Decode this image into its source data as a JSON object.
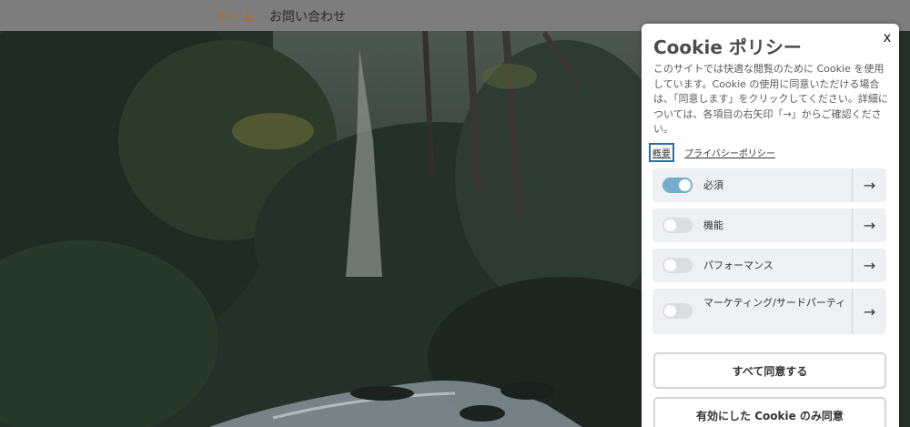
{
  "nav": {
    "home": "ホーム",
    "contact": "お問い合わせ"
  },
  "cookie_panel": {
    "title": "Cookie ポリシー",
    "close": "x",
    "description": "このサイトでは快適な閲覧のために Cookie を使用しています。Cookie の使用に同意いただける場合は、「同意します」をクリックしてください。詳細については、各項目の右矢印「→」からご確認ください。",
    "tabs": [
      {
        "label": "概要",
        "active": true
      },
      {
        "label": "プライバシーポリシー",
        "active": false
      }
    ],
    "categories": [
      {
        "label": "必須",
        "enabled": true
      },
      {
        "label": "機能",
        "enabled": false
      },
      {
        "label": "パフォーマンス",
        "enabled": false
      },
      {
        "label": "マーケティング/サードパーティ",
        "enabled": false
      }
    ],
    "arrow_glyph": "→",
    "accept_all": "すべて同意する",
    "accept_selected": "有効にした Cookie のみ同意"
  },
  "colors": {
    "accent_nav": "#b76a1c",
    "toggle_on": "#74aecb",
    "toggle_off": "#dcdde3"
  }
}
